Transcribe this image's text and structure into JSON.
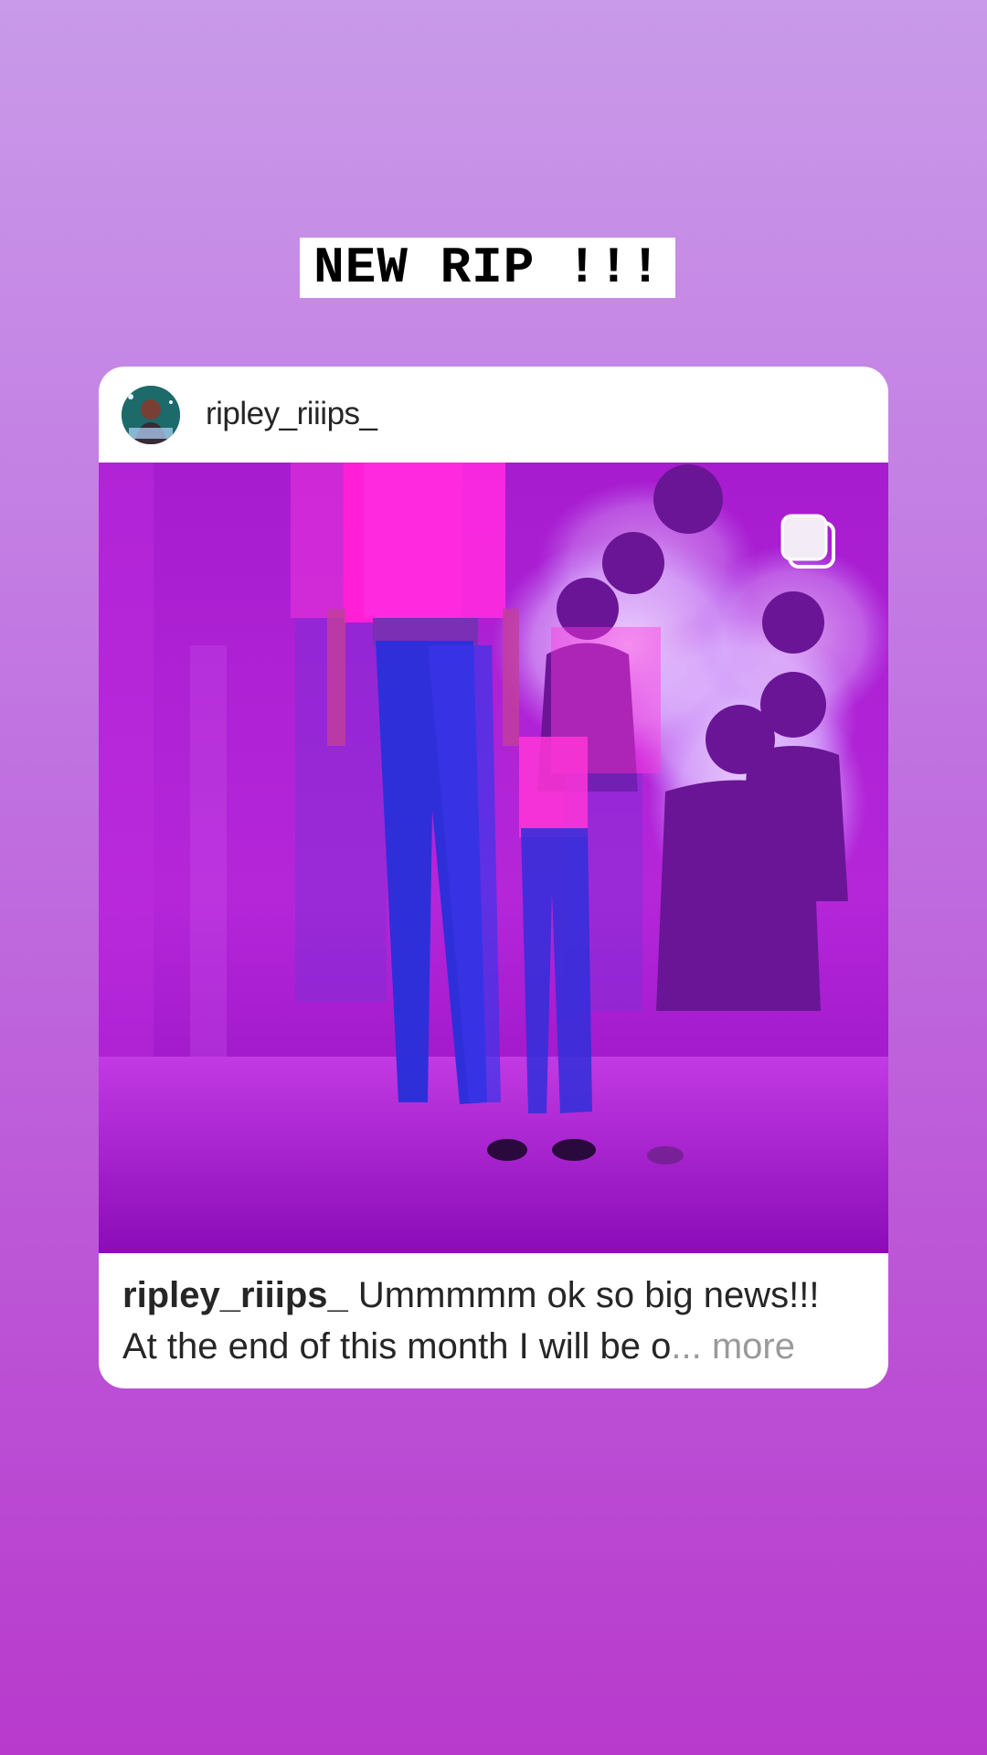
{
  "story": {
    "sticker_text": "NEW RIP !!!"
  },
  "post": {
    "username": "ripley_riiips_",
    "avatar_icon": "profile-avatar-icon",
    "media_type_icon": "multiple-photos-icon",
    "caption": {
      "username": "ripley_riiips_",
      "line1": "Ummmmm ok so big news!!!",
      "line2": "At the end of this month I will be o",
      "ellipsis": "...",
      "more": "more"
    }
  },
  "colors": {
    "background_top": "#c99ae9",
    "background_bottom": "#b83acd",
    "card": "#ffffff",
    "photo_magenta": "#ff1fd6",
    "photo_blue": "#2f2fd9"
  }
}
